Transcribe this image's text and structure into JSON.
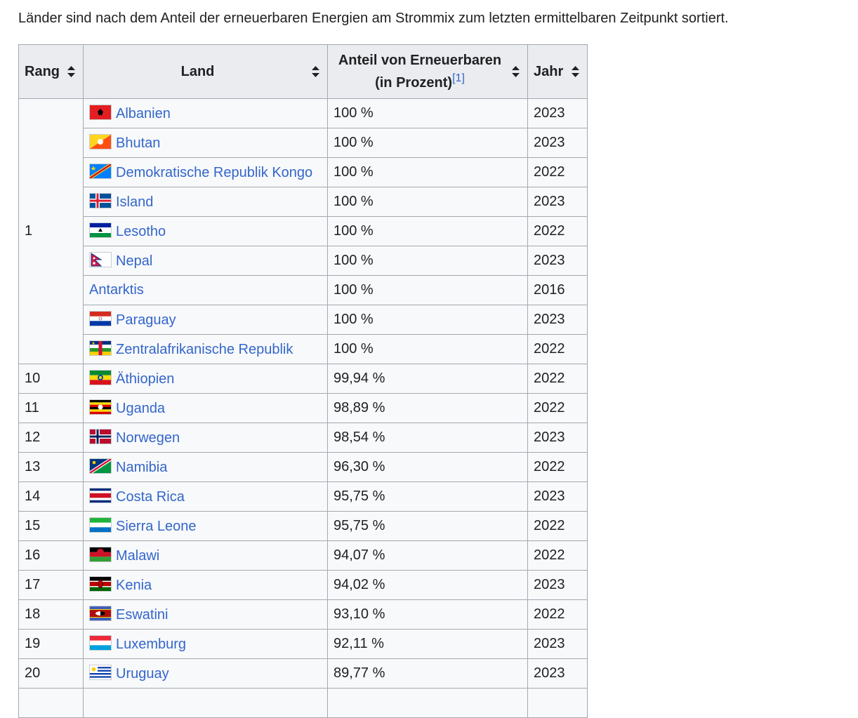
{
  "intro": "Länder sind nach dem Anteil der erneuerbaren Energien am Strommix zum letzten ermittelbaren Zeitpunkt sortiert.",
  "headers": {
    "rang": "Rang",
    "land": "Land",
    "anteil_line1": "Anteil von Erneuerbaren",
    "anteil_line2": "(in Prozent)",
    "anteil_ref": "[1]",
    "jahr": "Jahr"
  },
  "rank_group1": "1",
  "rows_group1": [
    {
      "country": "Albanien",
      "flag": "albania-flag",
      "share": "100 %",
      "year": "2023"
    },
    {
      "country": "Bhutan",
      "flag": "bhutan-flag",
      "share": "100 %",
      "year": "2023"
    },
    {
      "country": "Demokratische Republik Kongo",
      "flag": "dr-congo-flag",
      "share": "100 %",
      "year": "2022"
    },
    {
      "country": "Island",
      "flag": "iceland-flag",
      "share": "100 %",
      "year": "2023"
    },
    {
      "country": "Lesotho",
      "flag": "lesotho-flag",
      "share": "100 %",
      "year": "2022"
    },
    {
      "country": "Nepal",
      "flag": "nepal-flag",
      "share": "100 %",
      "year": "2023"
    },
    {
      "country": "Antarktis",
      "flag": "",
      "share": "100 %",
      "year": "2016"
    },
    {
      "country": "Paraguay",
      "flag": "paraguay-flag",
      "share": "100 %",
      "year": "2023"
    },
    {
      "country": "Zentralafrikanische Republik",
      "flag": "car-flag",
      "share": "100 %",
      "year": "2022"
    }
  ],
  "rows_rest": [
    {
      "rank": "10",
      "country": "Äthiopien",
      "flag": "ethiopia-flag",
      "share": "99,94 %",
      "year": "2022"
    },
    {
      "rank": "11",
      "country": "Uganda",
      "flag": "uganda-flag",
      "share": "98,89 %",
      "year": "2022"
    },
    {
      "rank": "12",
      "country": "Norwegen",
      "flag": "norway-flag",
      "share": "98,54 %",
      "year": "2023"
    },
    {
      "rank": "13",
      "country": "Namibia",
      "flag": "namibia-flag",
      "share": "96,30 %",
      "year": "2022"
    },
    {
      "rank": "14",
      "country": "Costa Rica",
      "flag": "costa-rica-flag",
      "share": "95,75 %",
      "year": "2023"
    },
    {
      "rank": "15",
      "country": "Sierra Leone",
      "flag": "sierra-leone-flag",
      "share": "95,75 %",
      "year": "2022"
    },
    {
      "rank": "16",
      "country": "Malawi",
      "flag": "malawi-flag",
      "share": "94,07 %",
      "year": "2022"
    },
    {
      "rank": "17",
      "country": "Kenia",
      "flag": "kenya-flag",
      "share": "94,02 %",
      "year": "2023"
    },
    {
      "rank": "18",
      "country": "Eswatini",
      "flag": "eswatini-flag",
      "share": "93,10 %",
      "year": "2022"
    },
    {
      "rank": "19",
      "country": "Luxemburg",
      "flag": "luxembourg-flag",
      "share": "92,11 %",
      "year": "2023"
    },
    {
      "rank": "20",
      "country": "Uruguay",
      "flag": "uruguay-flag",
      "share": "89,77 %",
      "year": "2023"
    }
  ],
  "colors": {
    "link": "#3366cc",
    "header_bg": "#eaecf0",
    "cell_bg": "#f8f9fa",
    "border": "#a2a9b1"
  }
}
